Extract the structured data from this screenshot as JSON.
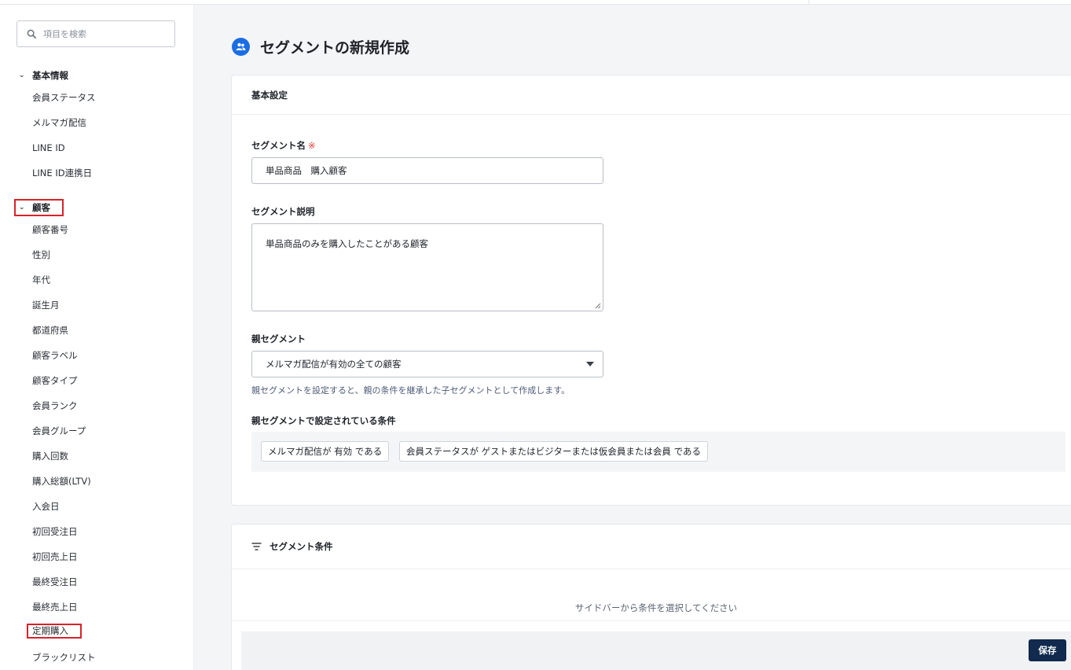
{
  "search": {
    "placeholder": "項目を検索"
  },
  "sidebar": {
    "groups": [
      {
        "label": "基本情報",
        "items": [
          "会員ステータス",
          "メルマガ配信",
          "LINE ID",
          "LINE ID連携日"
        ]
      },
      {
        "label": "顧客",
        "items": [
          "顧客番号",
          "性別",
          "年代",
          "誕生月",
          "都道府県",
          "顧客ラベル",
          "顧客タイプ",
          "会員ランク",
          "会員グループ",
          "購入回数",
          "購入総額(LTV)",
          "入会日",
          "初回受注日",
          "初回売上日",
          "最終受注日",
          "最終売上日",
          "定期購入",
          "ブラックリスト"
        ]
      }
    ]
  },
  "page": {
    "title": "セグメントの新規作成"
  },
  "basic": {
    "header": "基本設定",
    "name_label": "セグメント名",
    "required_mark": "※",
    "name_value": "単品商品　購入顧客",
    "desc_label": "セグメント説明",
    "desc_value": "単品商品のみを購入したことがある顧客",
    "parent_label": "親セグメント",
    "parent_value": "メルマガ配信が有効の全ての顧客",
    "parent_hint": "親セグメントを設定すると、親の条件を継承した子セグメントとして作成します。",
    "parent_cond_label": "親セグメントで設定されている条件",
    "conditions": [
      "メルマガ配信が 有効 である",
      "会員ステータスが ゲストまたはビジターまたは仮会員または会員 である"
    ]
  },
  "conditions_card": {
    "header": "セグメント条件",
    "empty_text": "サイドバーから条件を選択してください"
  },
  "footer": {
    "save_label": "保存"
  },
  "colors": {
    "accent": "#1a6de3",
    "save_button": "#112a4d",
    "highlight_box": "#d7232a",
    "required": "#e03b3b"
  }
}
